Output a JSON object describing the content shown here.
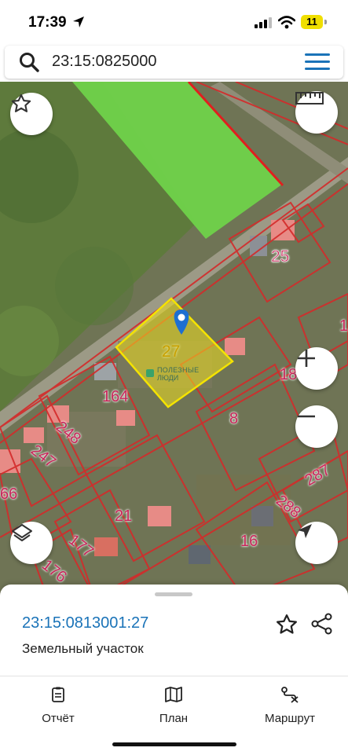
{
  "status": {
    "time": "17:39",
    "battery": "11"
  },
  "search": {
    "value": "23:15:0825000"
  },
  "map": {
    "parcel_labels": [
      "25",
      "27",
      "164",
      "248",
      "247",
      "66",
      "8",
      "18",
      "1",
      "287",
      "288",
      "21",
      "177",
      "176",
      "16"
    ],
    "watermark_line1": "ПОЛЕЗНЫЕ",
    "watermark_line2": "ЛЮДИ",
    "selected_fill": "#f0e020",
    "boundary_color": "#d42a2a",
    "field_color": "#6fd24a"
  },
  "sheet": {
    "cadastral_number": "23:15:0813001:27",
    "parcel_type": "Земельный участок"
  },
  "tabs": [
    {
      "label": "Отчёт",
      "icon": "report-icon"
    },
    {
      "label": "План",
      "icon": "map-plan-icon"
    },
    {
      "label": "Маршрут",
      "icon": "route-icon"
    }
  ],
  "colors": {
    "accent": "#1a73b8"
  }
}
